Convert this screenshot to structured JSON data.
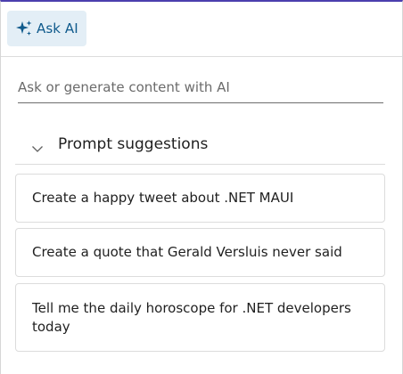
{
  "toolbar": {
    "ask_ai_label": "Ask AI",
    "ask_ai_icon": "sparkle-icon",
    "accent_color": "#0f5a8c",
    "button_bg": "#e3eef6"
  },
  "prompt": {
    "placeholder": "Ask or generate content with AI",
    "value": ""
  },
  "suggestions": {
    "header": "Prompt suggestions",
    "expanded": true,
    "items": [
      {
        "text": "Create a happy tweet about .NET MAUI"
      },
      {
        "text": "Create a quote that Gerald Versluis never said"
      },
      {
        "text": "Tell me the daily horoscope for .NET developers today"
      }
    ]
  }
}
